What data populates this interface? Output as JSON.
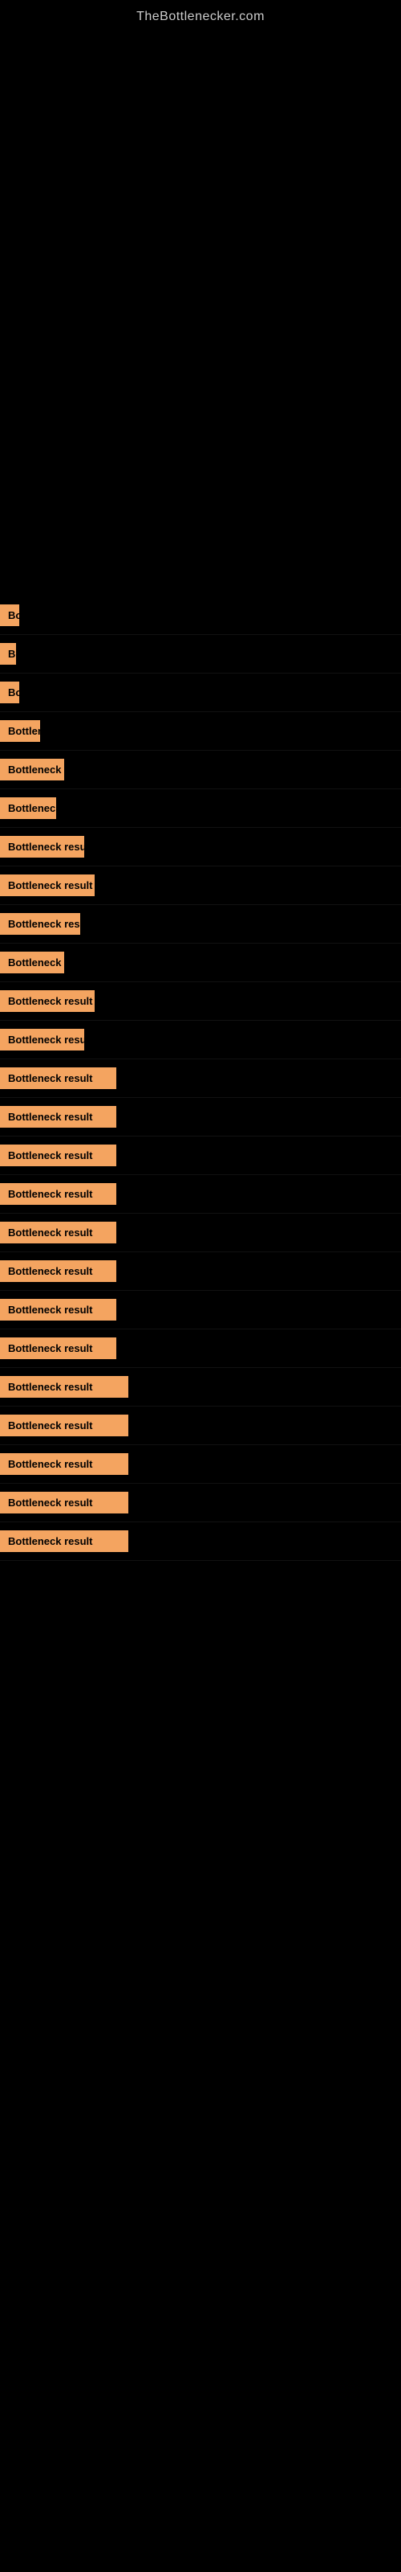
{
  "header": {
    "site_title": "TheBottlenecker.com"
  },
  "results": [
    {
      "id": 1,
      "label": "Bottleneck result",
      "badge_width": 24,
      "badge_class": "badge-xs"
    },
    {
      "id": 2,
      "label": "Bottleneck result",
      "badge_width": 12,
      "badge_class": "badge-xs"
    },
    {
      "id": 3,
      "label": "Bottleneck result",
      "badge_width": 24,
      "badge_class": "badge-xs"
    },
    {
      "id": 4,
      "label": "Bottleneck result",
      "badge_width": 50,
      "badge_class": "badge-md"
    },
    {
      "id": 5,
      "label": "Bottleneck result",
      "badge_width": 80,
      "badge_class": "badge-lg"
    },
    {
      "id": 6,
      "label": "Bottleneck result",
      "badge_width": 70,
      "badge_class": "badge-lg"
    },
    {
      "id": 7,
      "label": "Bottleneck result",
      "badge_width": 100,
      "badge_class": "badge-xl"
    },
    {
      "id": 8,
      "label": "Bottleneck result",
      "badge_width": 110,
      "badge_class": "badge-xl"
    },
    {
      "id": 9,
      "label": "Bottleneck result",
      "badge_width": 95,
      "badge_class": "badge-xl"
    },
    {
      "id": 10,
      "label": "Bottleneck result",
      "badge_width": 115,
      "badge_class": "badge-2xl"
    },
    {
      "id": 11,
      "label": "Bottleneck result",
      "badge_width": 80,
      "badge_class": "badge-lg"
    },
    {
      "id": 12,
      "label": "Bottleneck result",
      "badge_width": 115,
      "badge_class": "badge-2xl"
    },
    {
      "id": 13,
      "label": "Bottleneck result",
      "badge_width": 100,
      "badge_class": "badge-xl"
    },
    {
      "id": 14,
      "label": "Bottleneck result",
      "badge_width": 140,
      "badge_class": "badge-3xl"
    },
    {
      "id": 15,
      "label": "Bottleneck result",
      "badge_width": 140,
      "badge_class": "badge-3xl"
    },
    {
      "id": 16,
      "label": "Bottleneck result",
      "badge_width": 140,
      "badge_class": "badge-3xl"
    },
    {
      "id": 17,
      "label": "Bottleneck result",
      "badge_width": 140,
      "badge_class": "badge-3xl"
    },
    {
      "id": 18,
      "label": "Bottleneck result",
      "badge_width": 140,
      "badge_class": "badge-3xl"
    },
    {
      "id": 19,
      "label": "Bottleneck result",
      "badge_width": 140,
      "badge_class": "badge-3xl"
    },
    {
      "id": 20,
      "label": "Bottleneck result",
      "badge_width": 140,
      "badge_class": "badge-3xl"
    },
    {
      "id": 21,
      "label": "Bottleneck result",
      "badge_width": 140,
      "badge_class": "badge-3xl"
    },
    {
      "id": 22,
      "label": "Bottleneck result",
      "badge_width": 160,
      "badge_class": "badge-full"
    },
    {
      "id": 23,
      "label": "Bottleneck result",
      "badge_width": 160,
      "badge_class": "badge-full"
    },
    {
      "id": 24,
      "label": "Bottleneck result",
      "badge_width": 160,
      "badge_class": "badge-full"
    },
    {
      "id": 25,
      "label": "Bottleneck result",
      "badge_width": 160,
      "badge_class": "badge-full"
    }
  ]
}
